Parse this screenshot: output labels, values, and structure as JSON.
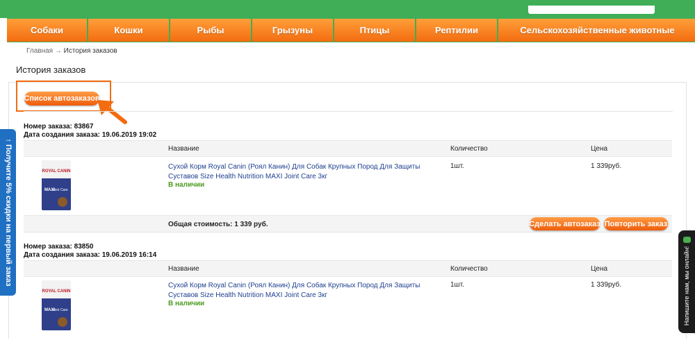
{
  "nav": {
    "items": [
      {
        "label": "Собаки"
      },
      {
        "label": "Кошки"
      },
      {
        "label": "Рыбы"
      },
      {
        "label": "Грызуны"
      },
      {
        "label": "Птицы"
      },
      {
        "label": "Рептилии"
      },
      {
        "label": "Сельскохозяйственные животные"
      }
    ]
  },
  "breadcrumb": {
    "home": "Главная",
    "separator": "→",
    "current": "История заказов"
  },
  "page": {
    "title": "История заказов",
    "autoorder_list_button": "Список автозаказов"
  },
  "table_headers": {
    "name": "Название",
    "qty": "Количество",
    "price": "Цена"
  },
  "orders": [
    {
      "number_label": "Номер заказа: 83867",
      "date_label": "Дата создания заказа: 19.06.2019 19:02",
      "product": "Сухой Корм Royal Canin (Роял Канин) Для Собак Крупных Пород Для Защиты Суставов Size Health Nutrition MAXI Joint Care 3кг",
      "stock": "В наличии",
      "qty": "1шт.",
      "price": "1 339руб.",
      "total": "Общая стоимость: 1 339 руб.",
      "make_autoorder": "Сделать автозаказ",
      "repeat_order": "Повторить заказ"
    },
    {
      "number_label": "Номер заказа: 83850",
      "date_label": "Дата создания заказа: 19.06.2019 16:14",
      "product": "Сухой Корм Royal Canin (Роял Канин) Для Собак Крупных Пород Для Защиты Суставов Size Health Nutrition MAXI Joint Care 3кг",
      "stock": "В наличии",
      "qty": "1шт.",
      "price": "1 339руб."
    }
  ],
  "product_image": {
    "brand": "ROYAL CANIN",
    "line": "MAXI",
    "variant": "Joint Care"
  },
  "side_promo": "↑ Получите 5% скидки на первый заказ",
  "chat": "Напишите нам, мы онлайн!",
  "colors": {
    "green": "#3fae57",
    "orange": "#f36c10",
    "link": "#1d3f8f",
    "in_stock": "#4b9a1e",
    "promo_blue": "#1f6fc2"
  }
}
